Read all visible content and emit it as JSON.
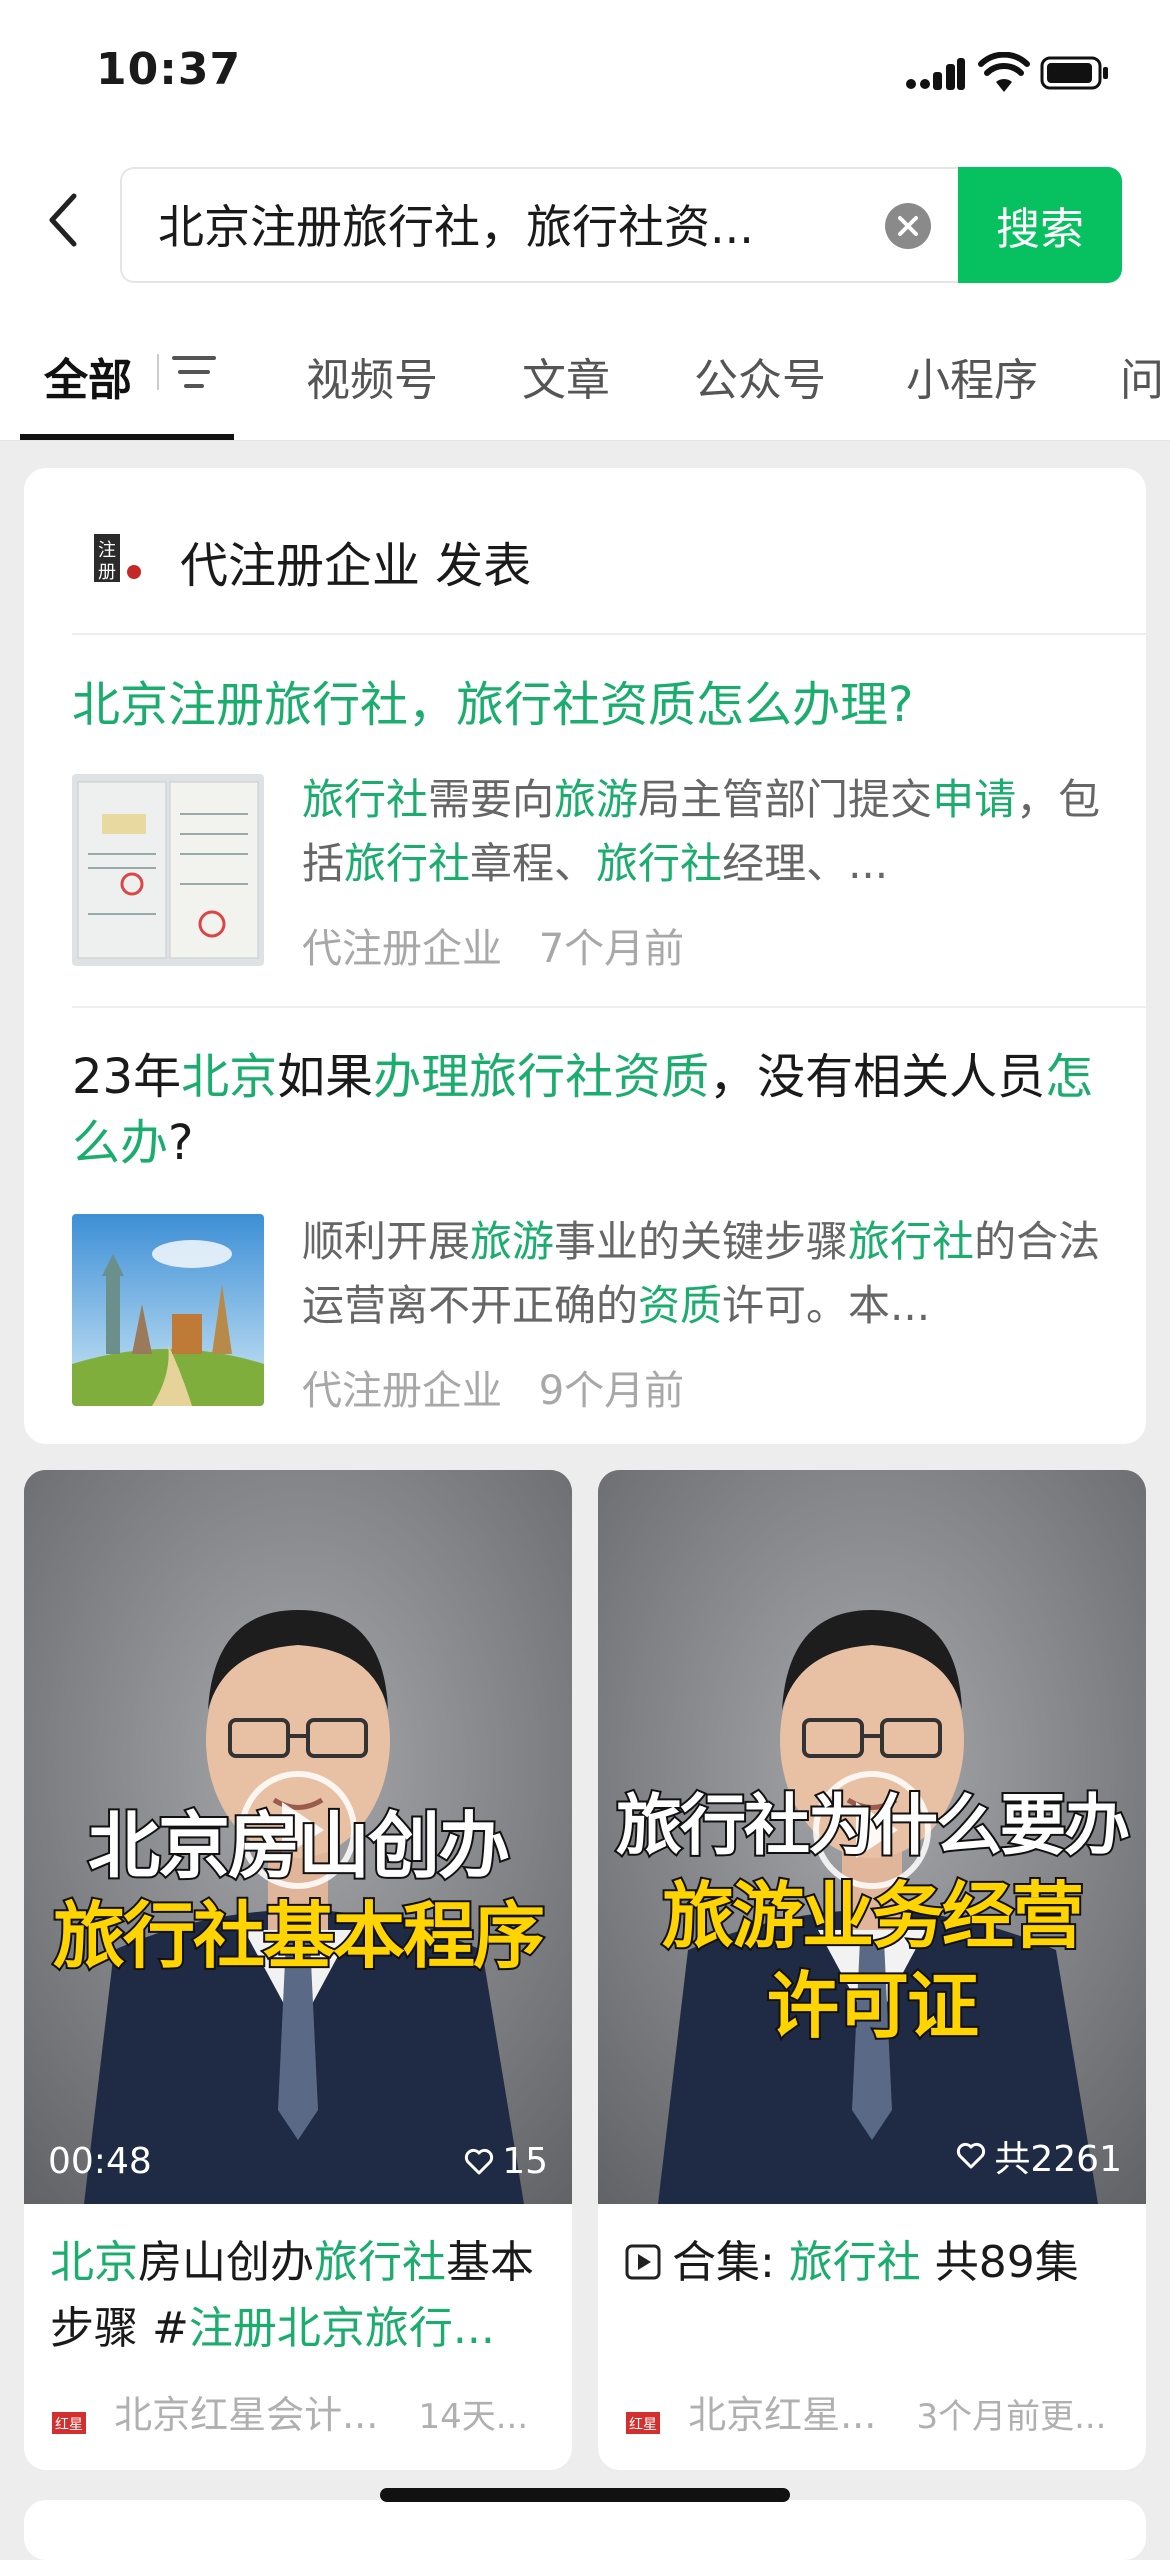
{
  "status": {
    "time": "10:37"
  },
  "search": {
    "query": "北京注册旅行社，旅行社资...",
    "button": "搜索"
  },
  "tabs": [
    {
      "label": "全部"
    },
    {
      "label": "视频号"
    },
    {
      "label": "文章"
    },
    {
      "label": "公众号"
    },
    {
      "label": "小程序"
    },
    {
      "label": "问"
    }
  ],
  "card": {
    "publisher": "代注册企业 发表",
    "publisher_logo_text": "注册",
    "articles": [
      {
        "title": "北京注册旅行社，旅行社资质怎么办理?",
        "snippet_parts": [
          {
            "t": "旅行社",
            "h": true
          },
          {
            "t": "需要向",
            "h": false
          },
          {
            "t": "旅游",
            "h": true
          },
          {
            "t": "局主管部门提交",
            "h": false
          },
          {
            "t": "申请",
            "h": true
          },
          {
            "t": "，包括",
            "h": false
          },
          {
            "t": "旅行社",
            "h": true
          },
          {
            "t": "章程、",
            "h": false
          },
          {
            "t": "旅行社",
            "h": true
          },
          {
            "t": "经理、...",
            "h": false
          }
        ],
        "source": "代注册企业",
        "time": "7个月前"
      },
      {
        "title_parts": [
          {
            "t": "23年",
            "h": false
          },
          {
            "t": "北京",
            "h": true
          },
          {
            "t": "如果",
            "h": false
          },
          {
            "t": "办理旅行社资质",
            "h": true
          },
          {
            "t": "，没有相关人员",
            "h": false
          },
          {
            "t": "怎么办",
            "h": true
          },
          {
            "t": "?",
            "h": false
          }
        ],
        "snippet_parts": [
          {
            "t": "顺利开展",
            "h": false
          },
          {
            "t": "旅游",
            "h": true
          },
          {
            "t": "事业的关键步骤",
            "h": false
          },
          {
            "t": "旅行社",
            "h": true
          },
          {
            "t": "的合法运营离不开正确的",
            "h": false
          },
          {
            "t": "资质",
            "h": true
          },
          {
            "t": "许可。本...",
            "h": false
          }
        ],
        "source": "代注册企业",
        "time": "9个月前"
      }
    ]
  },
  "videos": [
    {
      "overlay_line1": "北京房山创办",
      "overlay_line2": "旅行社基本程序",
      "duration": "00:48",
      "likes": "15",
      "caption_parts": [
        {
          "t": "北京",
          "h": true
        },
        {
          "t": "房山创办",
          "h": false
        },
        {
          "t": "旅行社",
          "h": true
        },
        {
          "t": "基本步骤 #",
          "h": false
        },
        {
          "t": "注册北京旅行...",
          "h": true
        }
      ],
      "author": "北京红星会计...",
      "time": "14天..."
    },
    {
      "overlay_line1": "旅行社为什么要办",
      "overlay_line2": "旅游业务经营",
      "overlay_line3": "许可证",
      "likes": "共2261",
      "collection_prefix": "合集: ",
      "collection_name": "旅行社",
      "collection_count": " 共89集",
      "author": "北京红星...",
      "time": "3个月前更..."
    }
  ],
  "colors": {
    "accent": "#07c160",
    "highlight": "#1aad6e"
  }
}
